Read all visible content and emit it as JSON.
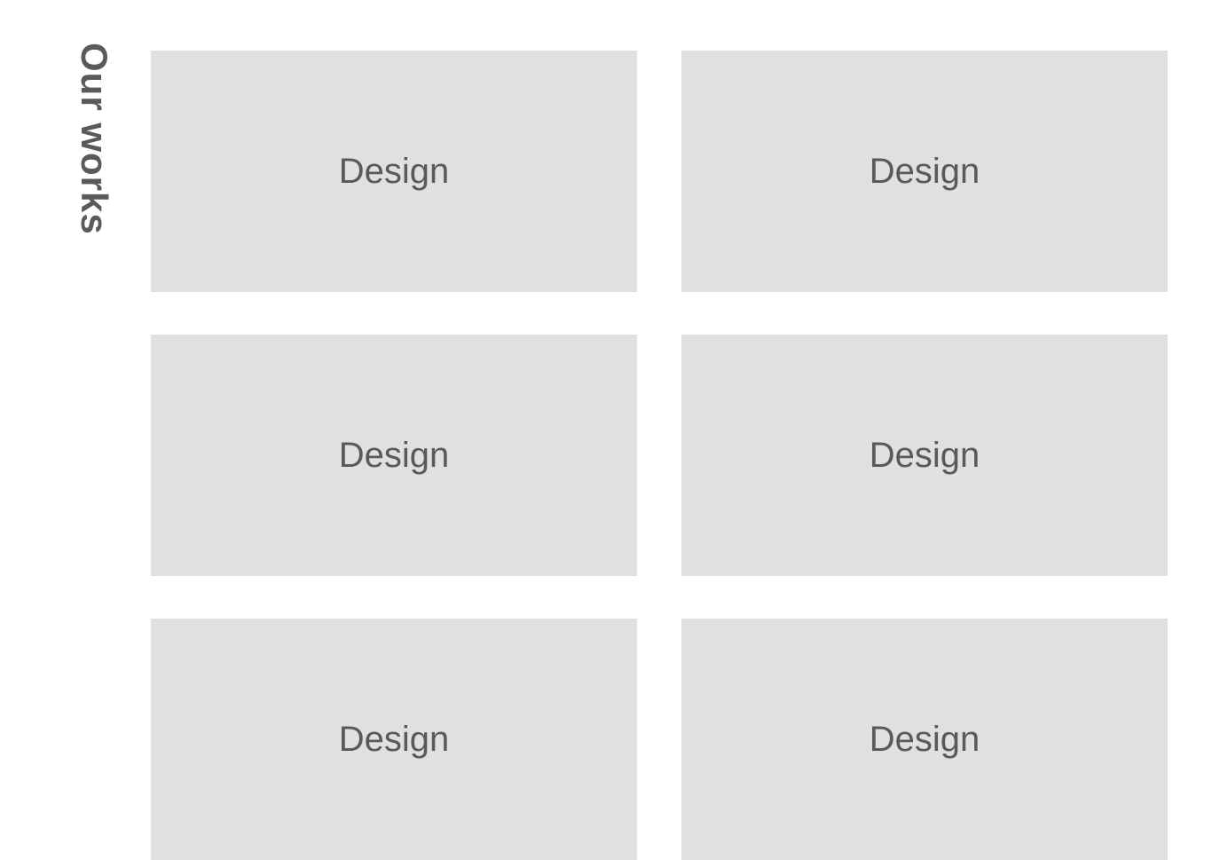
{
  "heading": "Our works",
  "cards": [
    {
      "label": "Design"
    },
    {
      "label": "Design"
    },
    {
      "label": "Design"
    },
    {
      "label": "Design"
    },
    {
      "label": "Design"
    },
    {
      "label": "Design"
    }
  ]
}
